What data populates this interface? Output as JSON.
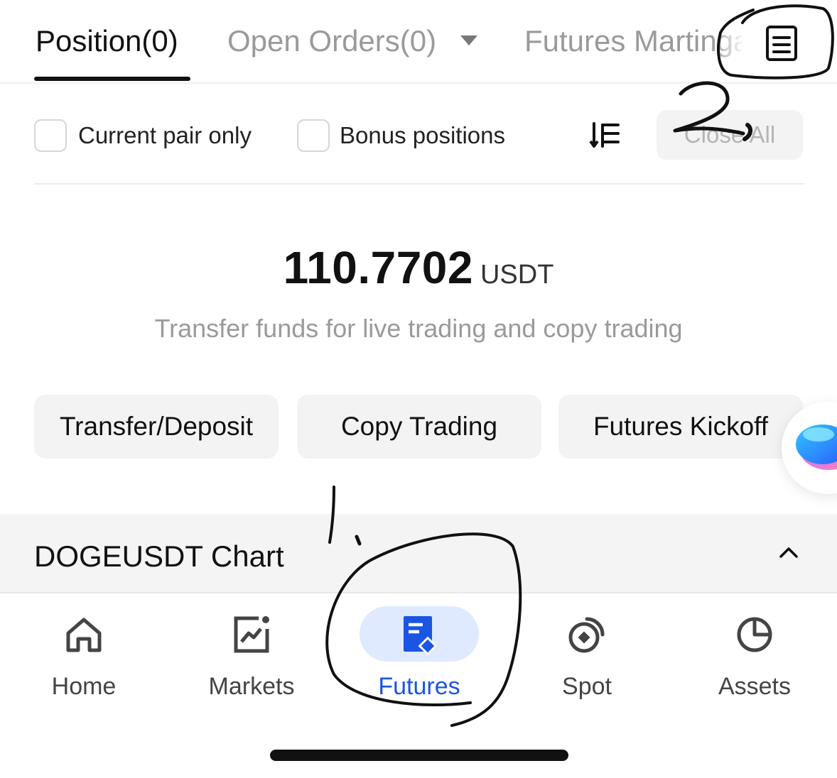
{
  "tabs": {
    "position_label": "Position(0)",
    "open_orders_label": "Open Orders(0)",
    "martingale_label": "Futures Martingale"
  },
  "filters": {
    "current_pair_label": "Current pair only",
    "bonus_positions_label": "Bonus positions",
    "close_all_label": "Close All"
  },
  "balance": {
    "value": "110.7702",
    "unit": "USDT",
    "subtitle": "Transfer funds for live trading and copy trading"
  },
  "actions": [
    {
      "label": "Transfer/Deposit"
    },
    {
      "label": "Copy Trading"
    },
    {
      "label": "Futures Kickoff"
    }
  ],
  "chart": {
    "title": "DOGEUSDT Chart"
  },
  "nav": [
    {
      "label": "Home",
      "icon": "home-icon"
    },
    {
      "label": "Markets",
      "icon": "markets-icon"
    },
    {
      "label": "Futures",
      "icon": "futures-icon",
      "active": true
    },
    {
      "label": "Spot",
      "icon": "spot-icon"
    },
    {
      "label": "Assets",
      "icon": "assets-icon"
    }
  ],
  "annotations": {
    "mark_1": "1.",
    "mark_2": "2."
  },
  "colors": {
    "accent": "#1a55e3",
    "active_pill": "#dfe9ff",
    "muted_text": "#9a9a9a",
    "button_bg": "#f3f3f3",
    "ink": "#111111"
  }
}
